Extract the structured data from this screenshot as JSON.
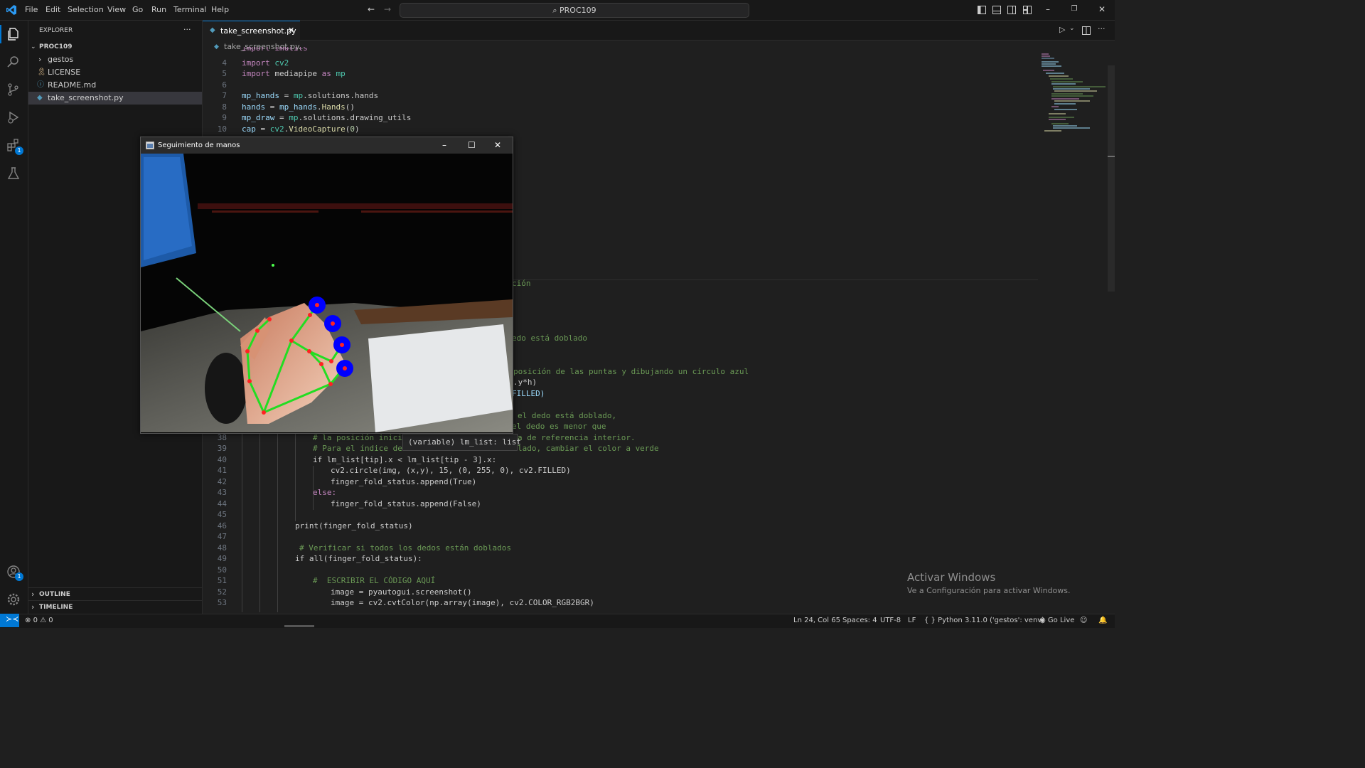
{
  "titlebar": {
    "menus": [
      "File",
      "Edit",
      "Selection",
      "View",
      "Go",
      "Run",
      "Terminal",
      "Help"
    ],
    "search_text": "PROC109"
  },
  "sidebar": {
    "title": "EXPLORER",
    "more": "···",
    "root": "PROC109",
    "items": [
      {
        "label": "gestos",
        "icon": "chevron-right-icon"
      },
      {
        "label": "LICENSE",
        "icon": "license-icon"
      },
      {
        "label": "README.md",
        "icon": "info-icon"
      },
      {
        "label": "take_screenshot.py",
        "icon": "python-file-icon"
      }
    ],
    "outline": "OUTLINE",
    "timeline": "TIMELINE"
  },
  "editor": {
    "tab_label": "take_screenshot.py",
    "breadcrumb_file": "take_screenshot.py",
    "breadcrumb_rest": "...",
    "lines_top": [
      {
        "n": "4",
        "text": "import cv2"
      },
      {
        "n": "5",
        "text": "import mediapipe as mp"
      },
      {
        "n": "6",
        "text": ""
      },
      {
        "n": "7",
        "text": "mp_hands = mp.solutions.hands"
      },
      {
        "n": "8",
        "text": "hands = mp_hands.Hands()"
      },
      {
        "n": "9",
        "text": "mp_draw = mp.solutions.drawing_utils"
      },
      {
        "n": "10",
        "text": "cap = cv2.VideoCapture(0)"
      }
    ],
    "fragments": {
      "f1": "ción",
      "f2": "edo está doblado",
      "f3": "posición de las puntas y dibujando un círculo azul",
      "f4": ".y*h)",
      "f5": "FILLED)",
      "f6": "el dedo está doblado,",
      "f7": "el dedo es menor que",
      "f8_a": "# la posición inicia",
      "f8_b": "a de referencia interior.",
      "f9_a": "# Para el índice del",
      "f9_b": "lado, cambiar el color a verde"
    },
    "lines_bottom": [
      {
        "n": "38"
      },
      {
        "n": "39"
      },
      {
        "n": "40"
      },
      {
        "n": "41"
      },
      {
        "n": "42"
      },
      {
        "n": "43"
      },
      {
        "n": "44"
      },
      {
        "n": "45"
      },
      {
        "n": "46"
      },
      {
        "n": "47"
      },
      {
        "n": "48"
      },
      {
        "n": "49"
      },
      {
        "n": "50"
      },
      {
        "n": "51"
      },
      {
        "n": "52"
      },
      {
        "n": "53"
      }
    ],
    "code": {
      "l40": "if lm_list[tip].x < lm_list[tip - 3].x:",
      "l41": "cv2.circle(img, (x,y), 15, (0, 255, 0), cv2.FILLED)",
      "l42": "finger_fold_status.append(True)",
      "l43": "else:",
      "l44": "finger_fold_status.append(False)",
      "l46": "print(finger_fold_status)",
      "l48": "# Verificar si todos los dedos están doblados",
      "l49": "if all(finger_fold_status):",
      "l51": "#  ESCRIBIR EL CÓDIGO AQUÍ",
      "l52": "image = pyautogui.screenshot()",
      "l53": "image = cv2.cvtColor(np.array(image), cv2.COLOR_RGB2BGR)"
    }
  },
  "tooltip": {
    "text": "(variable) lm_list: list"
  },
  "cv_window": {
    "title": "Seguimiento de manos"
  },
  "watermark": {
    "title": "Activar Windows",
    "subtitle": "Ve a Configuración para activar Windows."
  },
  "statusbar": {
    "errors": "0",
    "warnings": "0",
    "position": "Ln 24, Col 65",
    "spaces": "Spaces: 4",
    "encoding": "UTF-8",
    "eol": "LF",
    "language": "Python",
    "interpreter": "3.11.0 ('gestos': venv)",
    "golive": "Go Live"
  },
  "badges": {
    "extensions": "1",
    "accounts": "1"
  },
  "colors": {
    "accent": "#0078d4",
    "hand_lines": "#22dd22",
    "hand_points": "#ff2222",
    "fingertip_circles": "#0000ff"
  }
}
